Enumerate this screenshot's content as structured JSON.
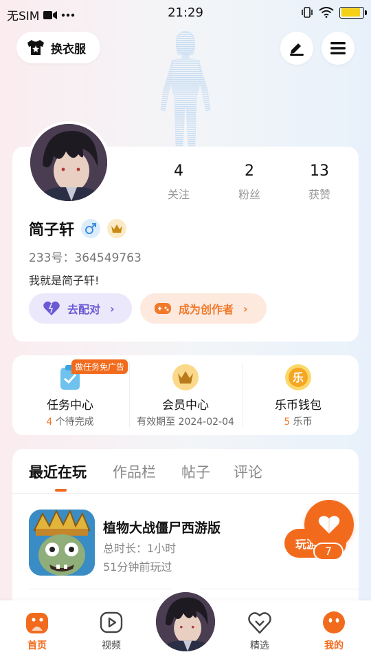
{
  "status_bar": {
    "carrier": "无SIM",
    "time": "21:29",
    "battery_level": 0.9,
    "battery_color": "#f5d017"
  },
  "header": {
    "outfit_label": "换衣服",
    "outfit_icon": "tshirt-icon",
    "edit_icon": "edit-icon",
    "menu_icon": "menu-icon"
  },
  "profile": {
    "name": "简子轩",
    "gender_icon": "male-icon",
    "vip_icon": "crown-icon",
    "id_text": "233号：364549763",
    "bio": "我就是简子轩!",
    "stats": [
      {
        "value": "4",
        "label": "关注"
      },
      {
        "value": "2",
        "label": "粉丝"
      },
      {
        "value": "13",
        "label": "获赞"
      }
    ],
    "match_label": "去配对",
    "creator_label": "成为创作者"
  },
  "services": {
    "ad_tag": "做任务免广告",
    "items": [
      {
        "title": "任务中心",
        "highlight": "4",
        "suffix": " 个待完成",
        "icon": "task-clipboard-icon"
      },
      {
        "title": "会员中心",
        "prefix": "有效期至 ",
        "date": "2024-02-04",
        "icon": "crown-icon"
      },
      {
        "title": "乐币钱包",
        "highlight": "5",
        "suffix": " 乐币",
        "icon": "coin-icon",
        "coin_char": "乐"
      }
    ]
  },
  "tabs": [
    "最近在玩",
    "作品栏",
    "帖子",
    "评论"
  ],
  "recent_game": {
    "title": "植物大战僵尸西游版",
    "duration": "总时长：1小时",
    "last_played": "51分钟前玩过",
    "play_label": "玩游"
  },
  "like": {
    "count": "7"
  },
  "bottom_nav": [
    {
      "label": "首页",
      "icon": "home-icon",
      "active": true
    },
    {
      "label": "视频",
      "icon": "video-play-icon",
      "active": false
    },
    {
      "label": "精选",
      "icon": "heart-shield-icon",
      "active": false
    },
    {
      "label": "我的",
      "icon": "profile-face-icon",
      "active": true
    }
  ],
  "colors": {
    "accent": "#f26b1d",
    "purple": "#6a5ad4",
    "gold": "#e8b33a"
  }
}
